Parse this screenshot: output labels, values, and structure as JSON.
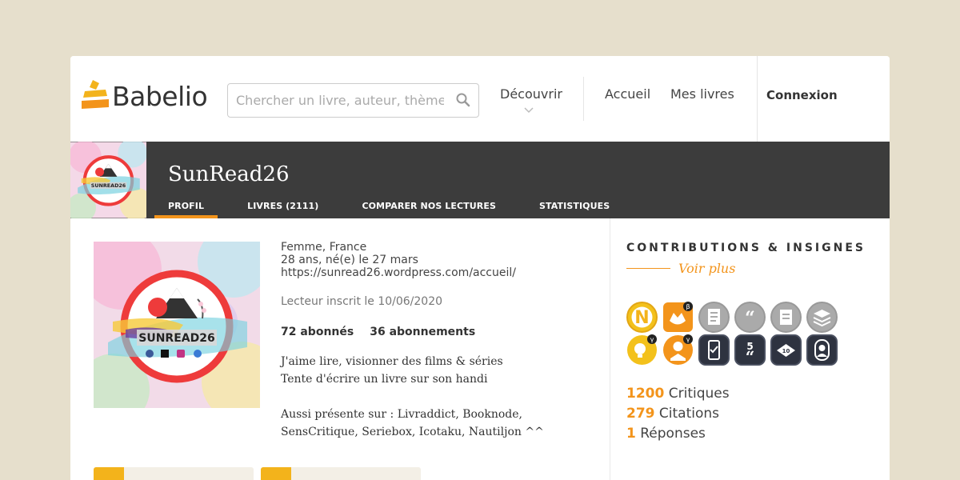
{
  "header": {
    "logo_text": "Babelio",
    "search_placeholder": "Chercher un livre, auteur, thème",
    "nav": {
      "discover": "Découvrir",
      "home": "Accueil",
      "my_books": "Mes livres",
      "login": "Connexion"
    }
  },
  "profile": {
    "username": "SunRead26",
    "avatar_text": "SUNREAD26",
    "tabs": [
      {
        "label": "PROFIL",
        "active": true
      },
      {
        "label": "LIVRES (2111)",
        "active": false
      },
      {
        "label": "COMPARER NOS LECTURES",
        "active": false
      },
      {
        "label": "STATISTIQUES",
        "active": false
      }
    ],
    "info": {
      "line1": "Femme, France",
      "line2": "28 ans, né(e) le 27 mars",
      "line3": "https://sunread26.wordpress.com/accueil/",
      "member_since": "Lecteur inscrit le 10/06/2020",
      "followers": "72 abonnés",
      "following": "36 abonnements"
    },
    "bio": {
      "line1": "J'aime lire, visionner des films & séries",
      "line2": "Tente d'écrire un livre sur son handi",
      "line3": "Aussi présente sur : Livraddict, Booknode, SensCritique, Seriebox, Icotaku, Nautiljon ^^"
    }
  },
  "contributions": {
    "title": "CONTRIBUTIONS & INSIGNES",
    "see_more": "Voir plus",
    "badges": [
      {
        "icon": "n-letter-icon",
        "style": "gold"
      },
      {
        "icon": "fox-beta-icon",
        "style": "orange"
      },
      {
        "icon": "document-icon",
        "style": "grey"
      },
      {
        "icon": "quote-1-icon",
        "style": "grey"
      },
      {
        "icon": "clipboard-icon",
        "style": "grey"
      },
      {
        "icon": "stack-icon",
        "style": "grey"
      },
      {
        "icon": "lightbulb-icon",
        "style": "gold"
      },
      {
        "icon": "reader-icon",
        "style": "orange"
      },
      {
        "icon": "tablet-icon",
        "style": "dark"
      },
      {
        "icon": "quote-5-icon",
        "style": "dark"
      },
      {
        "icon": "book-icon",
        "style": "dark"
      },
      {
        "icon": "profile-icon",
        "style": "dark"
      }
    ],
    "stats": [
      {
        "value": "1200",
        "label": "Critiques"
      },
      {
        "value": "279",
        "label": "Citations"
      },
      {
        "value": "1",
        "label": "Réponses"
      }
    ]
  },
  "colors": {
    "accent": "#f3941b",
    "bar": "#3c3c3c",
    "background": "#e6dfcc"
  }
}
